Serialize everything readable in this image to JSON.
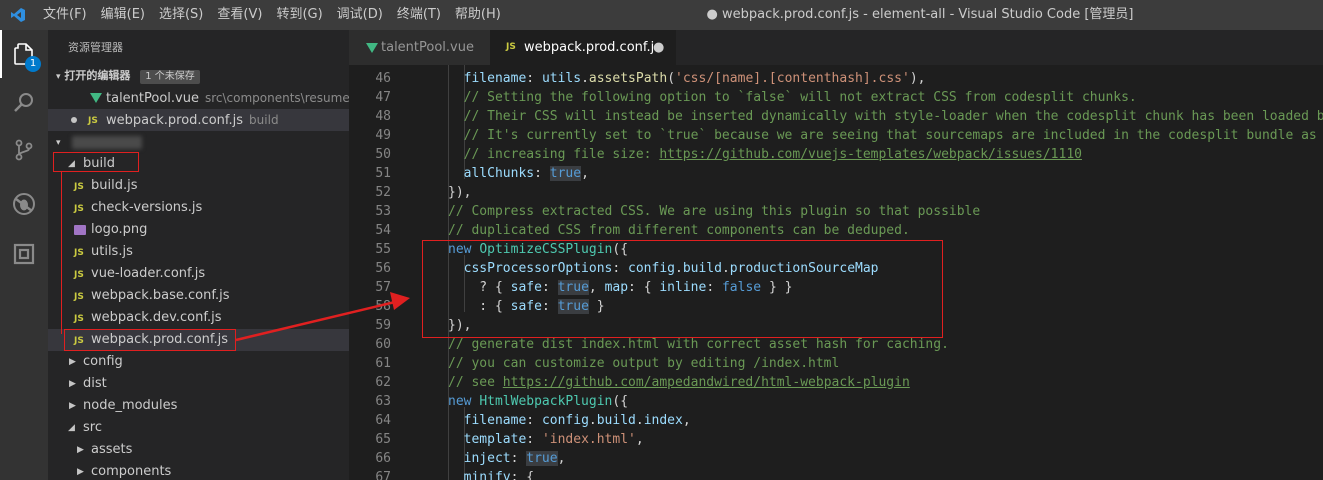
{
  "titlebar": {
    "menus": [
      "文件(F)",
      "编辑(E)",
      "选择(S)",
      "查看(V)",
      "转到(G)",
      "调试(D)",
      "终端(T)",
      "帮助(H)"
    ],
    "title": "● webpack.prod.conf.js - element-all - Visual Studio Code [管理员]"
  },
  "activitybar": {
    "icons": [
      "files-icon",
      "search-icon",
      "source-control-icon",
      "debug-icon",
      "extensions-icon"
    ],
    "badge": "1"
  },
  "sidebar": {
    "title": "资源管理器",
    "open_editors": {
      "label": "打开的编辑器",
      "badge": "1 个未保存",
      "items": [
        {
          "name": "talentPool.vue",
          "desc": "src\\components\\resumedat..."
        },
        {
          "name": "webpack.prod.conf.js",
          "desc": "build"
        }
      ]
    },
    "tree": {
      "build": "build",
      "build_files": [
        "build.js",
        "check-versions.js",
        "logo.png",
        "utils.js",
        "vue-loader.conf.js",
        "webpack.base.conf.js",
        "webpack.dev.conf.js",
        "webpack.prod.conf.js"
      ],
      "config": "config",
      "dist": "dist",
      "node_modules": "node_modules",
      "src": "src",
      "assets": "assets",
      "components": "components"
    }
  },
  "tabs": [
    {
      "label": "talentPool.vue",
      "icon": "vue-icon",
      "active": false
    },
    {
      "label": "webpack.prod.conf.js",
      "icon": "js-icon",
      "active": true,
      "dirty": "●"
    }
  ],
  "editor": {
    "lines": [
      {
        "n": "46",
        "html": "    <span class=\"p\">filename</span>: <span class=\"p\">utils</span>.<span class=\"f\">assetsPath</span>(<span class=\"s\">'css/[name].[contenthash].css'</span>),"
      },
      {
        "n": "47",
        "html": "    <span class=\"c\">// Setting the following option to `false` will not extract CSS from codesplit chunks.</span>"
      },
      {
        "n": "48",
        "html": "    <span class=\"c\">// Their CSS will instead be inserted dynamically with style-loader when the codesplit chunk has been loaded by webpack.</span>"
      },
      {
        "n": "49",
        "html": "    <span class=\"c\">// It's currently set to `true` because we are seeing that sourcemaps are included in the codesplit bundle as well when it's `false`,</span>"
      },
      {
        "n": "50",
        "html": "    <span class=\"c\">// increasing file size: <span class=\"u\">https://github.com/vuejs-templates/webpack/issues/1110</span></span>"
      },
      {
        "n": "51",
        "html": "    <span class=\"p\">allChunks</span>: <span class=\"k hl\">true</span>,"
      },
      {
        "n": "52",
        "html": "  }),"
      },
      {
        "n": "53",
        "html": "  <span class=\"c\">// Compress extracted CSS. We are using this plugin so that possible</span>"
      },
      {
        "n": "54",
        "html": "  <span class=\"c\">// duplicated CSS from different components can be deduped.</span>"
      },
      {
        "n": "55",
        "html": "  <span class=\"k\">new</span> <span class=\"t\">OptimizeCSSPlugin</span>({"
      },
      {
        "n": "56",
        "html": "    <span class=\"p\">cssProcessorOptions</span>: <span class=\"p\">config</span>.<span class=\"p\">build</span>.<span class=\"p\">productionSourceMap</span>"
      },
      {
        "n": "57",
        "html": "      ? { <span class=\"p\">safe</span>: <span class=\"k hl\">true</span>, <span class=\"p\">map</span>: { <span class=\"p\">inline</span>: <span class=\"k\">false</span> } }"
      },
      {
        "n": "58",
        "html": "      : { <span class=\"p\">safe</span>: <span class=\"k hl\">true</span> }"
      },
      {
        "n": "59",
        "html": "  }),"
      },
      {
        "n": "60",
        "html": "  <span class=\"c\">// generate dist index.html with correct asset hash for caching.</span>"
      },
      {
        "n": "61",
        "html": "  <span class=\"c\">// you can customize output by editing /index.html</span>"
      },
      {
        "n": "62",
        "html": "  <span class=\"c\">// see <span class=\"u\">https://github.com/ampedandwired/html-webpack-plugin</span></span>"
      },
      {
        "n": "63",
        "html": "  <span class=\"k\">new</span> <span class=\"t\">HtmlWebpackPlugin</span>({"
      },
      {
        "n": "64",
        "html": "    <span class=\"p\">filename</span>: <span class=\"p\">config</span>.<span class=\"p\">build</span>.<span class=\"p\">index</span>,"
      },
      {
        "n": "65",
        "html": "    <span class=\"p\">template</span>: <span class=\"s\">'index.html'</span>,"
      },
      {
        "n": "66",
        "html": "    <span class=\"p\">inject</span>: <span class=\"k hl\">true</span>,"
      },
      {
        "n": "67",
        "html": "    <span class=\"p\">minify</span>: {"
      }
    ]
  },
  "colors": {
    "annotation_red": "#e02020",
    "accent": "#007acc"
  }
}
